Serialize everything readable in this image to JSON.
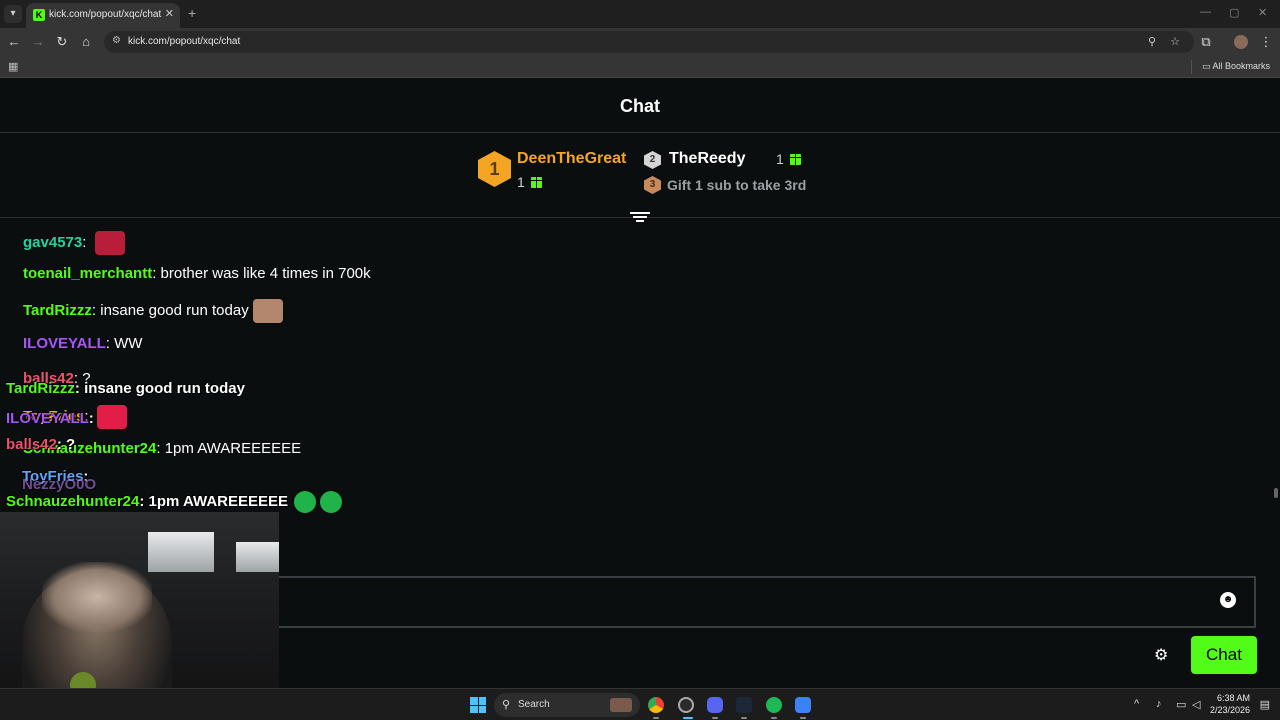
{
  "browser": {
    "tab_title": "kick.com/popout/xqc/chat",
    "tab_favicon": "K",
    "url": "kick.com/popout/xqc/chat",
    "all_bookmarks": "All Bookmarks"
  },
  "chat": {
    "title": "Chat",
    "leaderboard": {
      "first": {
        "rank": "1",
        "name": "DeenTheGreat",
        "count": "1"
      },
      "second": {
        "rank": "2",
        "name": "TheReedy",
        "count": "1"
      },
      "third": {
        "rank": "3",
        "text": "Gift 1 sub to take 3rd"
      }
    },
    "messages": [
      {
        "user": "gav4573",
        "color": "#22d3a0",
        "text": "",
        "emote": "#b81d3a"
      },
      {
        "user": "toenail_merchantt",
        "color": "#53fc18",
        "text": "brother was like 4 times in 700k",
        "emote": ""
      },
      {
        "user": "TardRizzz",
        "color": "#53fc18",
        "text": "insane good run today",
        "emote": "#b3866e"
      },
      {
        "user": "ILOVEYALL",
        "color": "#a855f7",
        "text": "WW",
        "emote": ""
      },
      {
        "user": "balls42",
        "color": "#f0506e",
        "text": "?",
        "emote": ""
      },
      {
        "user": "ToyFries",
        "color": "#f5a524",
        "text": "",
        "emote": "#e11d48"
      },
      {
        "user": "Schnauzehunter24",
        "color": "#53fc18",
        "text": "1pm AWAREEEEEE",
        "emote": ""
      }
    ],
    "colors": {
      "accent": "#53fc18",
      "gold": "#f5a524"
    },
    "chat_button": "Chat"
  },
  "overlay": {
    "lines": [
      {
        "user": "TardRizzz",
        "color": "#53fc18",
        "text": "insane good run today"
      },
      {
        "user": "ILOVEYALL",
        "color": "#a855f7",
        "text": ""
      },
      {
        "user": "balls42",
        "color": "#f0506e",
        "text": "?"
      },
      {
        "user": "ToyFries",
        "color": "#60a5fa",
        "text": ""
      },
      {
        "user": "NezzyO0O",
        "color": "#c084fc",
        "text": ""
      },
      {
        "user": "Schnauzehunter24",
        "color": "#53fc18",
        "text": "1pm AWAREEEEEE"
      }
    ]
  },
  "taskbar": {
    "search_label": "Search",
    "time": "6:38 AM",
    "date": "2/23/2026"
  }
}
